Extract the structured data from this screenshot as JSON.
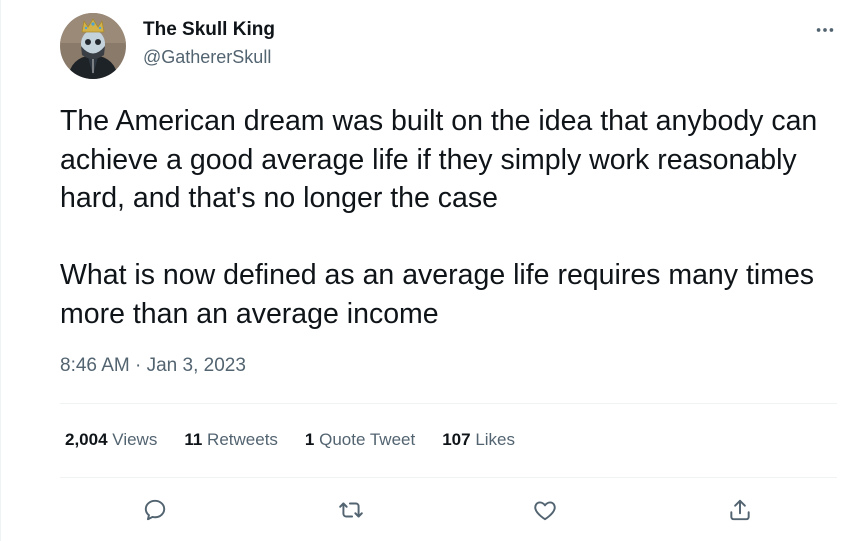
{
  "author": {
    "display_name": "The Skull King",
    "handle": "@GathererSkull",
    "avatar_icon": "skull-king-avatar"
  },
  "tweet": {
    "paragraphs": [
      "The American dream was built on the idea that anybody can achieve a good average life if they simply work reasonably hard, and that's no longer the case",
      "What is now defined as an average life requires many times more than an average income"
    ],
    "time": "8:46 AM",
    "separator": " · ",
    "date": "Jan 3, 2023"
  },
  "stats": {
    "views": {
      "count": "2,004",
      "label": "Views"
    },
    "retweets": {
      "count": "11",
      "label": "Retweets"
    },
    "quotes": {
      "count": "1",
      "label": "Quote Tweet"
    },
    "likes": {
      "count": "107",
      "label": "Likes"
    }
  },
  "actions": [
    "reply-icon",
    "retweet-icon",
    "like-icon",
    "share-icon"
  ],
  "colors": {
    "text_primary": "#0f1419",
    "text_secondary": "#536471",
    "divider": "#eff3f4"
  }
}
